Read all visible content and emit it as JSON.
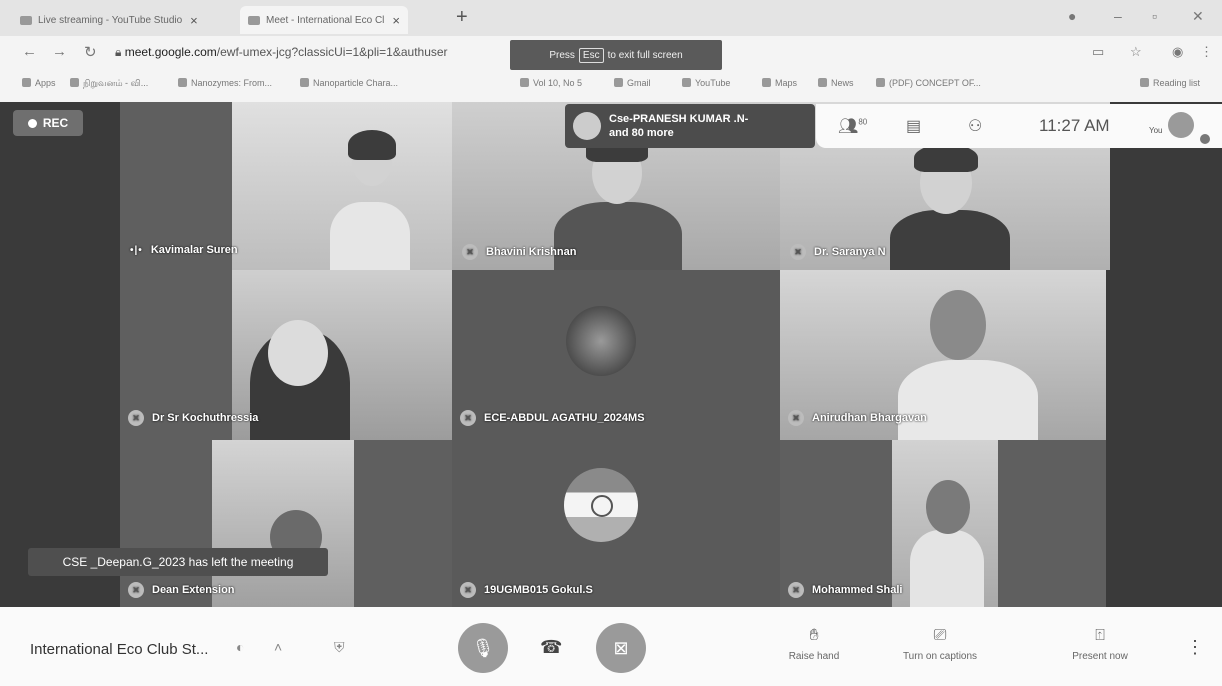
{
  "browser": {
    "tabs": [
      {
        "title": "Live streaming - YouTube Studio",
        "close": "×"
      },
      {
        "title": "Meet - International Eco Cl",
        "close": "×"
      }
    ],
    "new_tab": "+",
    "window_controls": {
      "minimize": "–",
      "maximize": "▫",
      "close": "✕"
    },
    "url_host": "meet.google.com",
    "url_path": "/ewf-umex-jcg?classicUi=1&pli=1&authuser",
    "bookmarks": [
      "Apps",
      "நிறுவனம் - வி...",
      "Nanozymes: From...",
      "Nanoparticle Chara...",
      "Vol 10, No 5",
      "Gmail",
      "YouTube",
      "Maps",
      "News",
      "(PDF) CONCEPT OF...",
      "Reading list"
    ],
    "fullscreen_notice": {
      "before": "Press",
      "key": "Esc",
      "after": "to exit full screen"
    }
  },
  "meet": {
    "rec_label": "REC",
    "presenter": {
      "line1": "Cse-PRANESH KUMAR .N-",
      "line2": "and 80 more"
    },
    "clock": "11:27 AM",
    "you_label": "You",
    "participant_count_badge": "80",
    "participants": [
      {
        "name": "Kavimalar Suren",
        "speaking": true
      },
      {
        "name": "Bhavini Krishnan",
        "muted": true
      },
      {
        "name": "Dr. Saranya N",
        "muted": true
      },
      {
        "name": "Dr Sr Kochuthressia",
        "muted": true
      },
      {
        "name": "ECE-ABDUL AGATHU_2024MS",
        "muted": true
      },
      {
        "name": "Anirudhan Bhargavan",
        "muted": true
      },
      {
        "name": "Dean Extension",
        "muted": true
      },
      {
        "name": "19UGMB015 Gokul.S",
        "muted": true
      },
      {
        "name": "Mohammed Shali",
        "muted": true
      }
    ],
    "toast": "CSE _Deepan.G_2023 has left the meeting",
    "meeting_name": "International Eco Club St...",
    "actions": {
      "raise_hand": "Raise hand",
      "captions": "Turn on captions",
      "present": "Present now"
    }
  }
}
